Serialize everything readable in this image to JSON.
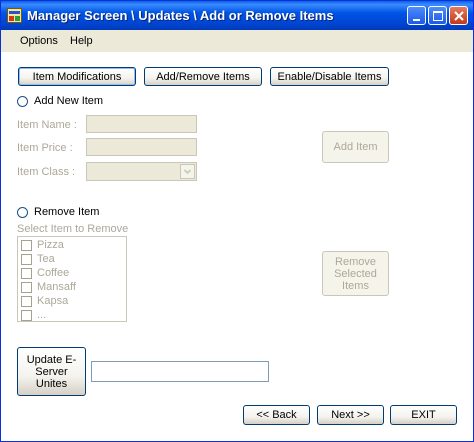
{
  "window": {
    "title": "Manager Screen \\ Updates \\ Add or Remove Items"
  },
  "menu": {
    "options": "Options",
    "help": "Help"
  },
  "tabs": {
    "item_modifications": "Item Modifications",
    "add_remove": "Add/Remove Items",
    "enable_disable": "Enable/Disable Items"
  },
  "add_section": {
    "radio_label": "Add New Item",
    "item_name_label": "Item Name :",
    "item_price_label": "Item Price :",
    "item_class_label": "Item Class :",
    "item_name_value": "",
    "item_price_value": "",
    "item_class_value": "",
    "add_button": "Add Item"
  },
  "remove_section": {
    "radio_label": "Remove Item",
    "select_label": "Select Item to Remove",
    "items": [
      "Pizza",
      "Tea",
      "Coffee",
      "Mansaff",
      "Kapsa",
      "..."
    ],
    "remove_button": "Remove Selected Items"
  },
  "update": {
    "button": "Update E-Server Unites",
    "value": ""
  },
  "nav": {
    "back": "<< Back",
    "next": "Next >>",
    "exit": "EXIT"
  },
  "colors": {
    "titlebar": "#0055e5",
    "window_bg": "#ece9d8",
    "panel_bg": "#ffffff",
    "disabled_text": "#aca899"
  }
}
